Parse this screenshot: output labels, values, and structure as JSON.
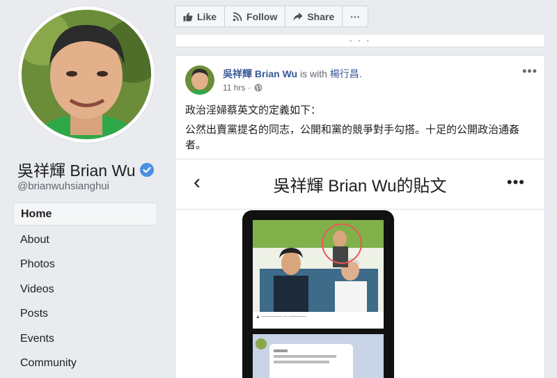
{
  "profile": {
    "name": "吳祥輝 Brian Wu",
    "handle": "@brianwuhsianghui",
    "verified_color": "#4a90e2"
  },
  "nav": {
    "items": [
      {
        "label": "Home",
        "active": true
      },
      {
        "label": "About"
      },
      {
        "label": "Photos"
      },
      {
        "label": "Videos"
      },
      {
        "label": "Posts"
      },
      {
        "label": "Events"
      },
      {
        "label": "Community"
      }
    ]
  },
  "actions": {
    "like": "Like",
    "follow": "Follow",
    "share": "Share",
    "more": "···"
  },
  "post": {
    "author": "吳祥輝 Brian Wu",
    "with_text": "is with",
    "tagged": "楊行昌.",
    "time": "11 hrs ·",
    "more": "•••",
    "text_line1": "政治淫婦蔡英文的定義如下：",
    "text_line2": "公然出賣黨提名的同志，公開和黨的競爭對手勾搭。十足的公開政治通姦者。"
  },
  "embed": {
    "back": "‹",
    "title": "吳祥輝 Brian Wu的貼文",
    "more": "•••"
  },
  "colors": {
    "link": "#385898",
    "background": "#e9ebee"
  }
}
